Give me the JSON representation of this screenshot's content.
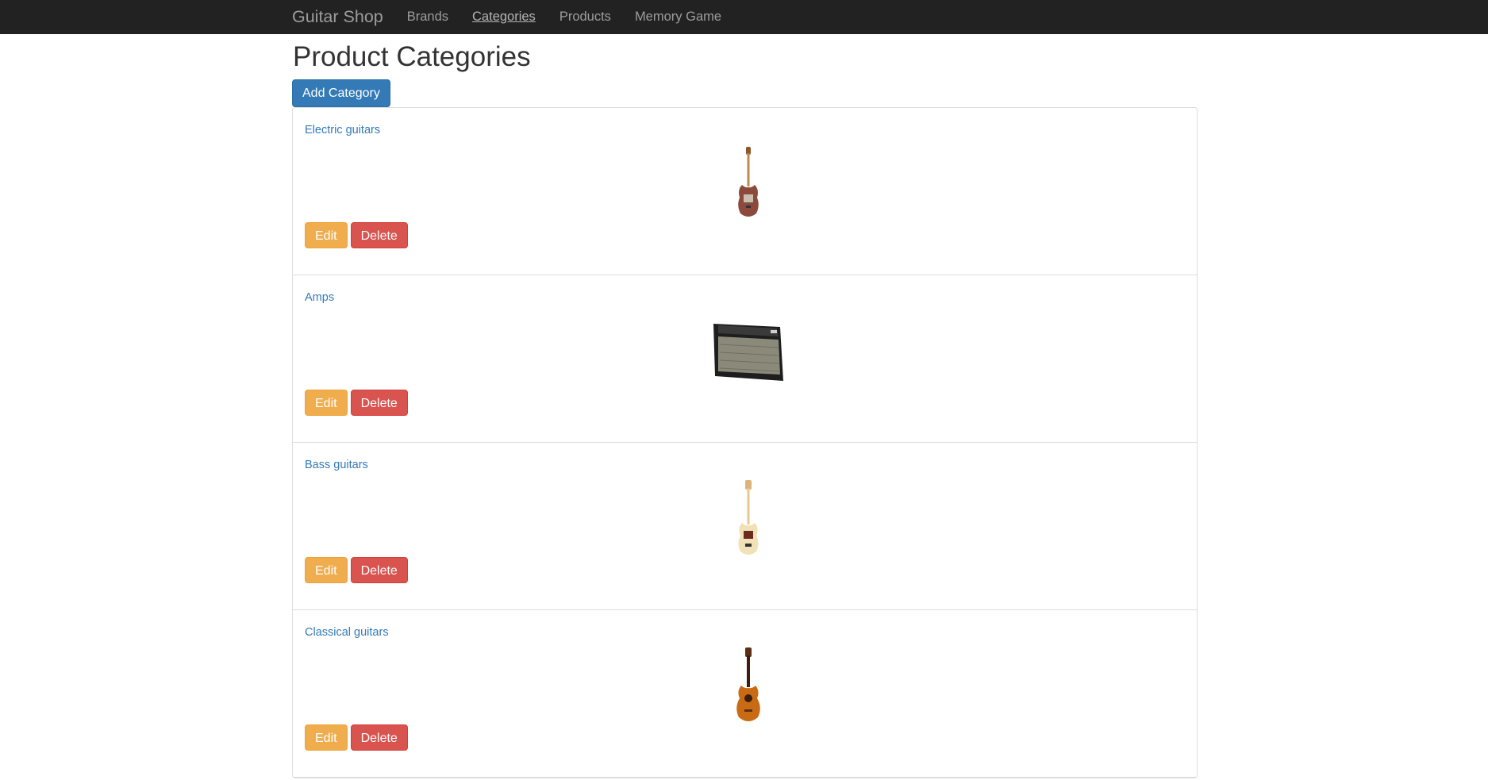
{
  "nav": {
    "brand": "Guitar Shop",
    "links": [
      "Brands",
      "Categories",
      "Products",
      "Memory Game"
    ],
    "active": "Categories"
  },
  "page": {
    "title": "Product Categories",
    "add_button": "Add Category"
  },
  "categories": [
    {
      "name": "Electric guitars",
      "image": "electric-guitar-icon",
      "edit": "Edit",
      "delete": "Delete"
    },
    {
      "name": "Amps",
      "image": "amplifier-icon",
      "edit": "Edit",
      "delete": "Delete"
    },
    {
      "name": "Bass guitars",
      "image": "bass-guitar-icon",
      "edit": "Edit",
      "delete": "Delete"
    },
    {
      "name": "Classical guitars",
      "image": "classical-guitar-icon",
      "edit": "Edit",
      "delete": "Delete"
    }
  ],
  "colors": {
    "navbar": "#222222",
    "primary": "#337ab7",
    "warning": "#f0ad4e",
    "danger": "#d9534f",
    "link": "#337ab7"
  }
}
